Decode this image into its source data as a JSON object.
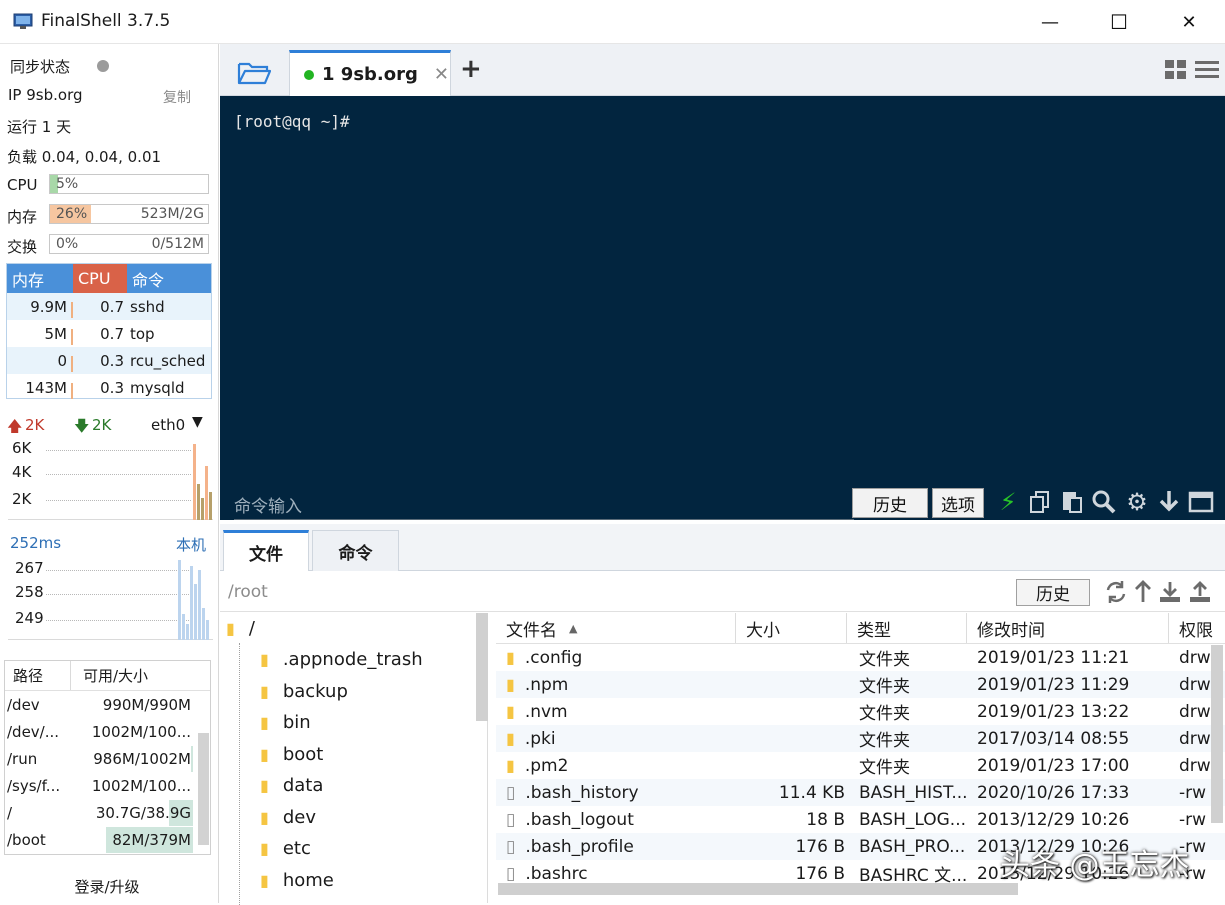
{
  "window": {
    "title": "FinalShell 3.7.5",
    "minimize": "—",
    "maximize": "☐",
    "close": "✕"
  },
  "status": {
    "sync_label": "同步状态",
    "ip_label": "IP 9sb.org",
    "copy_label": "复制",
    "uptime": "运行 1 天",
    "load": "负载 0.04, 0.04, 0.01",
    "cpu_label": "CPU",
    "cpu_pct": "5%",
    "cpu_value": 0.05,
    "mem_label": "内存",
    "mem_pct": "26%",
    "mem_value": 0.26,
    "mem_amount": "523M/2G",
    "swap_label": "交换",
    "swap_pct": "0%",
    "swap_value": 0,
    "swap_amount": "0/512M"
  },
  "processes": {
    "headers": [
      "内存",
      "CPU",
      "命令"
    ],
    "rows": [
      {
        "mem": "9.9M",
        "cpu": "0.7",
        "cmd": "sshd"
      },
      {
        "mem": "5M",
        "cpu": "0.7",
        "cmd": "top"
      },
      {
        "mem": "0",
        "cpu": "0.3",
        "cmd": "rcu_sched"
      },
      {
        "mem": "143M",
        "cpu": "0.3",
        "cmd": "mysqld"
      }
    ]
  },
  "network": {
    "up": "2K",
    "down": "2K",
    "interface": "eth0",
    "ticks": [
      "6K",
      "4K",
      "2K"
    ]
  },
  "ping": {
    "latency": "252ms",
    "target": "本机",
    "ticks": [
      "267",
      "258",
      "249"
    ]
  },
  "disks": {
    "headers": [
      "路径",
      "可用/大小"
    ],
    "rows": [
      {
        "path": "/dev",
        "size": "990M/990M",
        "used": 0.0
      },
      {
        "path": "/dev/...",
        "size": "1002M/100...",
        "used": 0.0
      },
      {
        "path": "/run",
        "size": "986M/1002M",
        "used": 0.02
      },
      {
        "path": "/sys/f...",
        "size": "1002M/100...",
        "used": 0.0
      },
      {
        "path": "/",
        "size": "30.7G/38.9G",
        "used": 0.21
      },
      {
        "path": "/boot",
        "size": "82M/379M",
        "used": 0.78
      }
    ]
  },
  "login_label": "登录/升级",
  "session": {
    "label": "1 9sb.org"
  },
  "terminal": {
    "prompt": "[root@qq ~]#",
    "input_placeholder": "命令输入",
    "history_btn": "历史",
    "options_btn": "选项"
  },
  "lower_tabs": {
    "files": "文件",
    "commands": "命令"
  },
  "path": {
    "current": "/root",
    "history_btn": "历史"
  },
  "tree": {
    "root": "/",
    "items": [
      ".appnode_trash",
      "backup",
      "bin",
      "boot",
      "data",
      "dev",
      "etc",
      "home"
    ]
  },
  "files": {
    "headers": {
      "name": "文件名",
      "size": "大小",
      "type": "类型",
      "modified": "修改时间",
      "perm": "权限"
    },
    "rows": [
      {
        "name": ".config",
        "size": "",
        "type": "文件夹",
        "modified": "2019/01/23 11:21",
        "perm": "drw",
        "folder": true
      },
      {
        "name": ".npm",
        "size": "",
        "type": "文件夹",
        "modified": "2019/01/23 11:29",
        "perm": "drw",
        "folder": true
      },
      {
        "name": ".nvm",
        "size": "",
        "type": "文件夹",
        "modified": "2019/01/23 13:22",
        "perm": "drw",
        "folder": true
      },
      {
        "name": ".pki",
        "size": "",
        "type": "文件夹",
        "modified": "2017/03/14 08:55",
        "perm": "drw",
        "folder": true
      },
      {
        "name": ".pm2",
        "size": "",
        "type": "文件夹",
        "modified": "2019/01/23 17:00",
        "perm": "drw",
        "folder": true
      },
      {
        "name": ".bash_history",
        "size": "11.4 KB",
        "type": "BASH_HIST...",
        "modified": "2020/10/26 17:33",
        "perm": "-rw",
        "folder": false
      },
      {
        "name": ".bash_logout",
        "size": "18 B",
        "type": "BASH_LOG...",
        "modified": "2013/12/29 10:26",
        "perm": "-rw",
        "folder": false
      },
      {
        "name": ".bash_profile",
        "size": "176 B",
        "type": "BASH_PRO...",
        "modified": "2013/12/29 10:26",
        "perm": "-rw",
        "folder": false
      },
      {
        "name": ".bashrc",
        "size": "176 B",
        "type": "BASHRC 文...",
        "modified": "2013/12/29 10:26",
        "perm": "-rw",
        "folder": false
      }
    ]
  },
  "watermark": "头条 @王忘杰",
  "colors": {
    "terminal_bg": "#02253f",
    "accent": "#2e7fd8",
    "proc_mem_header": "#4a90d9",
    "proc_cpu_header": "#d96248",
    "mem_fill": "#f6c6a0",
    "cpu_fill": "#a8d8a8",
    "connected": "#22b422"
  }
}
